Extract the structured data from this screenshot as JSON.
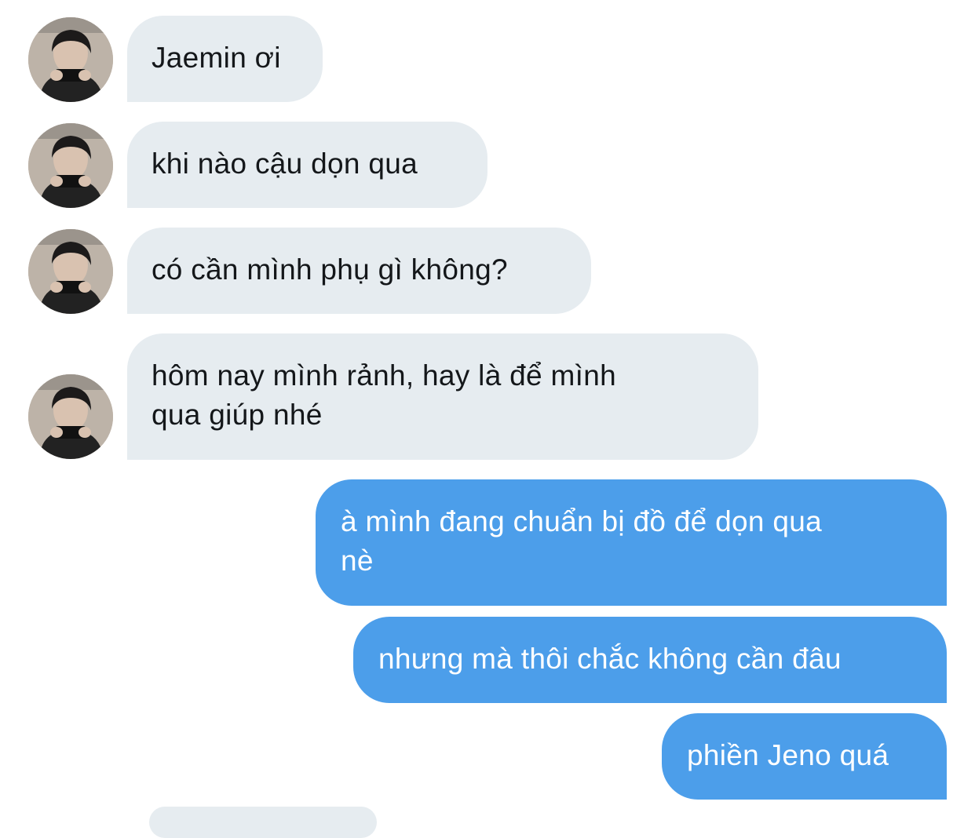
{
  "conversation": {
    "colors": {
      "incoming_bubble": "#e6ecf0",
      "incoming_text": "#14171a",
      "outgoing_bubble": "#4c9eea",
      "outgoing_text": "#ffffff"
    },
    "messages": [
      {
        "direction": "incoming",
        "lines": [
          "Jaemin ơi"
        ]
      },
      {
        "direction": "incoming",
        "lines": [
          "khi nào cậu dọn qua"
        ]
      },
      {
        "direction": "incoming",
        "lines": [
          "có cần mình phụ gì không?"
        ]
      },
      {
        "direction": "incoming",
        "lines": [
          "hôm nay mình rảnh, hay là để mình",
          "qua giúp nhé"
        ]
      },
      {
        "direction": "outgoing",
        "lines": [
          "à mình đang chuẩn bị đồ để dọn qua",
          "nè"
        ]
      },
      {
        "direction": "outgoing",
        "lines": [
          "nhưng mà thôi chắc không cần đâu"
        ]
      },
      {
        "direction": "outgoing",
        "lines": [
          "phiền Jeno quá"
        ]
      }
    ]
  }
}
